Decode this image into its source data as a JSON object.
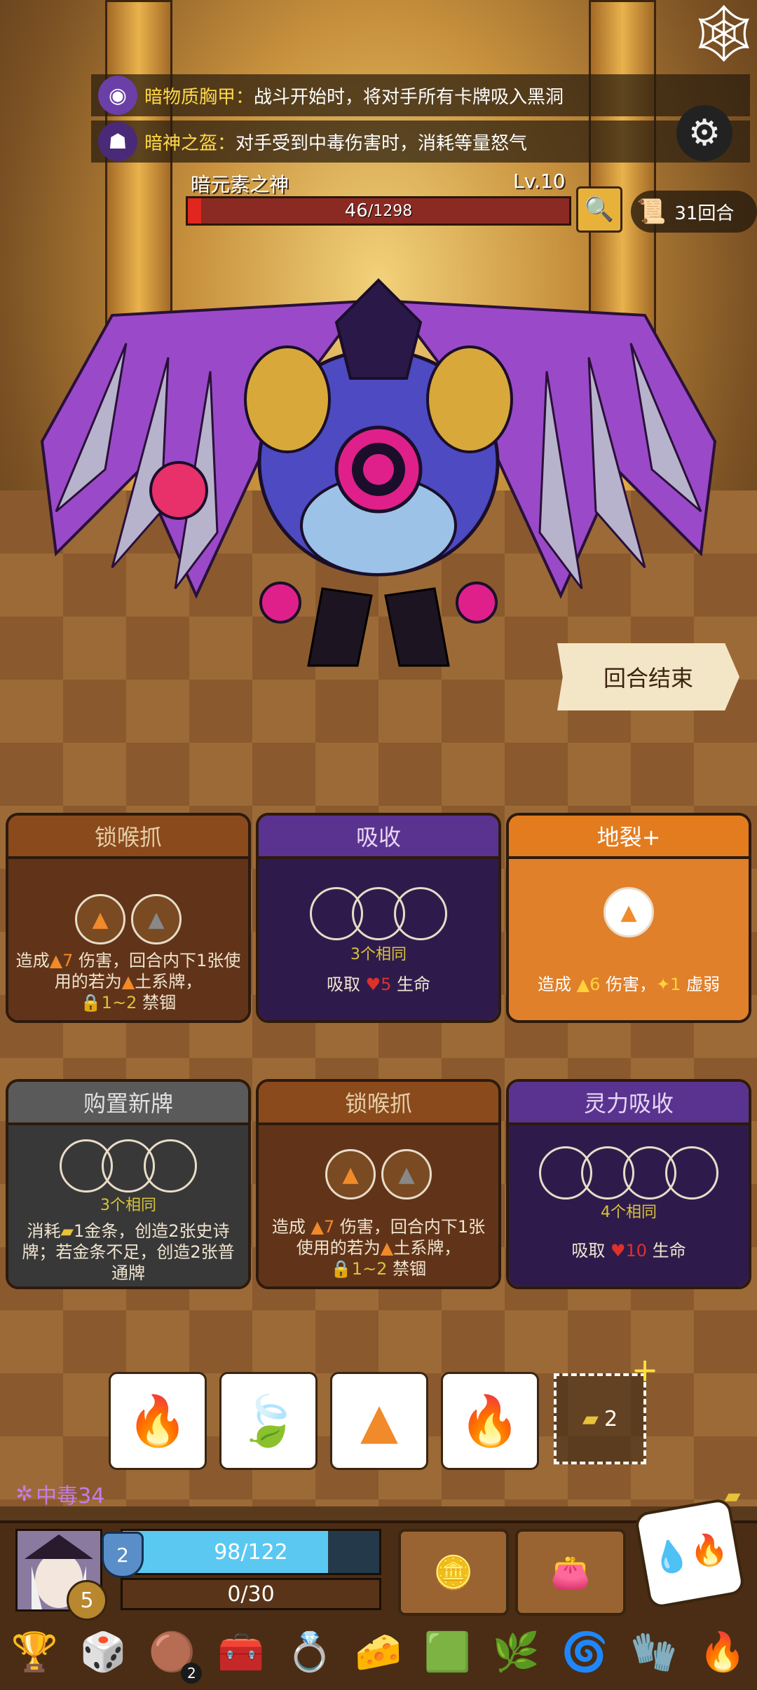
{
  "relics": [
    {
      "name": "暗物质胸甲：",
      "desc": "战斗开始时，将对手所有卡牌吸入黑洞",
      "icon": "dark-matter-armor-icon"
    },
    {
      "name": "暗神之盔：",
      "desc": "对手受到中毒伤害时，消耗等量怒气",
      "icon": "dark-god-helmet-icon"
    }
  ],
  "boss": {
    "name": "暗元素之神",
    "level": "Lv.10",
    "hp_text": "46",
    "hp_max": "/1298",
    "hp_fraction": 0.035
  },
  "turn_badge": "31回合",
  "end_turn_label": "回合结束",
  "cards": [
    {
      "title": "锁喉抓",
      "style": "brown",
      "note": "",
      "desc1": "造成",
      "dmg": "7",
      "desc2": " 伤害，回合内下1张使用的若为",
      "desc3": "土系牌，",
      "lock": "1~2",
      "lock_suffix": " 禁锢"
    },
    {
      "title": "吸收",
      "note": "3个相同",
      "desc1": "吸取 ",
      "value": "5",
      "desc2": " 生命"
    },
    {
      "title": "地裂+",
      "desc1": "造成 ",
      "dmg": "6",
      "desc2": " 伤害，",
      "weak": "1",
      "desc3": " 虚弱"
    },
    {
      "title": "购置新牌",
      "note": "3个相同",
      "desc": "消耗",
      "desc_gold": "1金条，创造2张史诗牌；若金条不足，创造2张普通牌"
    },
    {
      "title": "锁喉抓",
      "desc1": "造成 ",
      "dmg": "7",
      "desc2": " 伤害，回合内下1张使用的若为",
      "desc3": "土系牌，",
      "lock": "1~2",
      "lock_suffix": " 禁锢"
    },
    {
      "title": "灵力吸收",
      "note": "4个相同",
      "desc1": "吸取 ",
      "value": "10",
      "desc2": " 生命"
    }
  ],
  "dice": [
    "fire",
    "leaf",
    "earth",
    "fire"
  ],
  "gold_slot": {
    "count": "2",
    "plus": "+"
  },
  "status": {
    "label": "中毒34"
  },
  "player": {
    "shield": "2",
    "hp_text": "98/122",
    "hp_fraction": 0.8,
    "energy_text": "0/30",
    "level": "5"
  },
  "relic_strip": [
    {
      "name": "chalice-icon",
      "glyph": "🏆",
      "count": ""
    },
    {
      "name": "die-relic-icon",
      "glyph": "🎲",
      "count": ""
    },
    {
      "name": "button-relic-icon",
      "glyph": "🟤",
      "count": "2"
    },
    {
      "name": "treasure-chest-icon",
      "glyph": "🧰",
      "count": ""
    },
    {
      "name": "ring-icon",
      "glyph": "💍",
      "count": ""
    },
    {
      "name": "cheese-icon",
      "glyph": "🧀",
      "count": ""
    },
    {
      "name": "jade-tablet-icon",
      "glyph": "🟩",
      "count": ""
    },
    {
      "name": "vine-icon",
      "glyph": "🌿",
      "count": ""
    },
    {
      "name": "swirl-icon",
      "glyph": "🌀",
      "count": ""
    },
    {
      "name": "gauntlet-icon",
      "glyph": "🧤",
      "count": ""
    },
    {
      "name": "blue-flame-icon",
      "glyph": "🔥",
      "count": ""
    }
  ]
}
